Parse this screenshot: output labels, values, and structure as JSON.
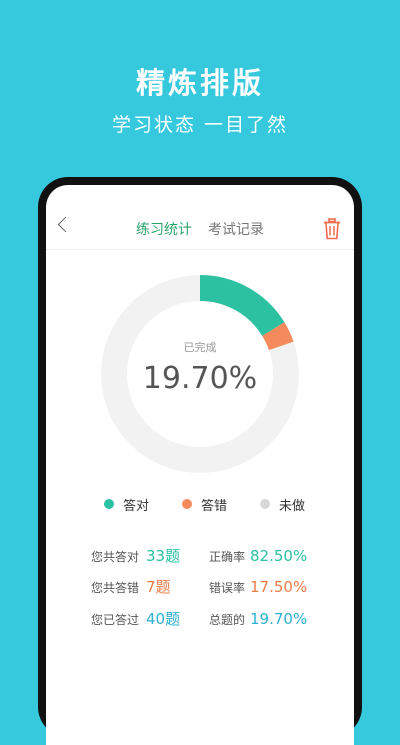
{
  "promo": {
    "title": "精炼排版",
    "subtitle": "学习状态 一目了然"
  },
  "nav": {
    "tabs": [
      {
        "label": "练习统计",
        "active": true
      },
      {
        "label": "考试记录",
        "active": false
      }
    ],
    "back_icon": "chevron-left-icon",
    "delete_icon": "trash-icon"
  },
  "donut": {
    "center_label": "已完成",
    "center_value": "19.70%",
    "correct_fraction": 0.1625,
    "wrong_fraction": 0.0345,
    "colors": {
      "correct": "#2cc1a1",
      "wrong": "#f58b5c",
      "undone": "#f2f2f2"
    }
  },
  "legend": [
    {
      "label": "答对",
      "color": "#2cc1a1"
    },
    {
      "label": "答错",
      "color": "#f58b5c"
    },
    {
      "label": "未做",
      "color": "#d8d8d8"
    }
  ],
  "stats": {
    "answered_correct_label": "您共答对",
    "answered_correct_value": "33题",
    "answered_wrong_label": "您共答错",
    "answered_wrong_value": "7题",
    "answered_total_label": "您已答过",
    "answered_total_value": "40题",
    "accuracy_label": "正确率",
    "accuracy_value": "82.50%",
    "error_rate_label": "错误率",
    "error_rate_value": "17.50%",
    "total_label": "总题的",
    "total_value": "19.70%"
  }
}
